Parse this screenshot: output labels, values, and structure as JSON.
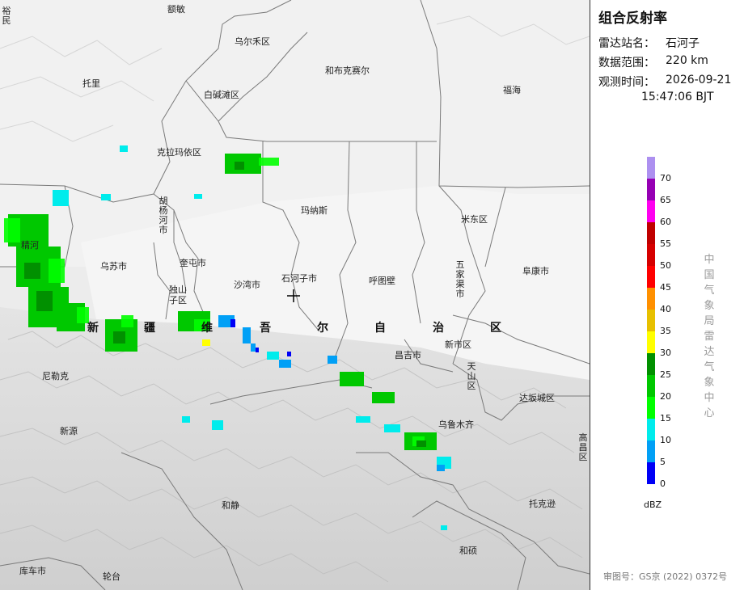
{
  "map": {
    "places": [
      {
        "id": "yumin",
        "label": "裕民"
      },
      {
        "id": "emin",
        "label": "额敏"
      },
      {
        "id": "wuerhe",
        "label": "乌尔禾区"
      },
      {
        "id": "hebukesaier",
        "label": "和布克赛尔"
      },
      {
        "id": "fuhai",
        "label": "福海"
      },
      {
        "id": "tuoli",
        "label": "托里"
      },
      {
        "id": "baijiantan",
        "label": "白碱滩区"
      },
      {
        "id": "kelamayi",
        "label": "克拉玛依区"
      },
      {
        "id": "huyanghe",
        "label": "胡杨河市"
      },
      {
        "id": "manasi",
        "label": "玛纳斯"
      },
      {
        "id": "midong",
        "label": "米东区"
      },
      {
        "id": "jinghe",
        "label": "精河"
      },
      {
        "id": "wusu",
        "label": "乌苏市"
      },
      {
        "id": "kuitun",
        "label": "奎屯市"
      },
      {
        "id": "dushanzi",
        "label": "独山子区"
      },
      {
        "id": "shawan",
        "label": "沙湾市"
      },
      {
        "id": "shihezi",
        "label": "石河子市"
      },
      {
        "id": "hutubi",
        "label": "呼图壁"
      },
      {
        "id": "wujiaqu",
        "label": "五家渠市"
      },
      {
        "id": "fukang",
        "label": "阜康市"
      },
      {
        "id": "changji",
        "label": "昌吉市"
      },
      {
        "id": "xinshi",
        "label": "新市区"
      },
      {
        "id": "tianshan",
        "label": "天山区"
      },
      {
        "id": "nileke",
        "label": "尼勒克"
      },
      {
        "id": "dabancheng",
        "label": "达坂城区"
      },
      {
        "id": "xinyuan",
        "label": "新源"
      },
      {
        "id": "wulumuqi",
        "label": "乌鲁木齐"
      },
      {
        "id": "gaochang",
        "label": "高昌区"
      },
      {
        "id": "hejing",
        "label": "和静"
      },
      {
        "id": "tuokexun",
        "label": "托克逊"
      },
      {
        "id": "heshuo",
        "label": "和硕"
      },
      {
        "id": "kuche",
        "label": "库车市"
      },
      {
        "id": "luntai",
        "label": "轮台"
      }
    ],
    "region_label": [
      "新",
      "疆",
      "维",
      "吾",
      "尔",
      "自",
      "治",
      "区"
    ],
    "radar_site_marker": "crosshair-icon"
  },
  "panel": {
    "title": "组合反射率",
    "station_label": "雷达站名：",
    "station_value": "石河子",
    "range_label": "数据范围：",
    "range_value": "220 km",
    "time_label": "观测时间：",
    "time_date": "2026-09-21",
    "time_clock": "15:47:06 BJT",
    "legend": {
      "unit": "dBZ",
      "colors": [
        "#0000f6",
        "#01a0f6",
        "#00ecec",
        "#01ff00",
        "#00c800",
        "#019000",
        "#ffff00",
        "#e7c000",
        "#ff9000",
        "#ff0000",
        "#d60000",
        "#c00000",
        "#ff00f0",
        "#9600b4",
        "#ad90f0"
      ],
      "ticks": [
        "70",
        "65",
        "60",
        "55",
        "50",
        "45",
        "40",
        "35",
        "30",
        "25",
        "20",
        "15",
        "10",
        "5",
        "0"
      ]
    },
    "agency": "中国气象局雷达气象中心",
    "review_no": "审图号：GS京 (2022) 0372号"
  }
}
